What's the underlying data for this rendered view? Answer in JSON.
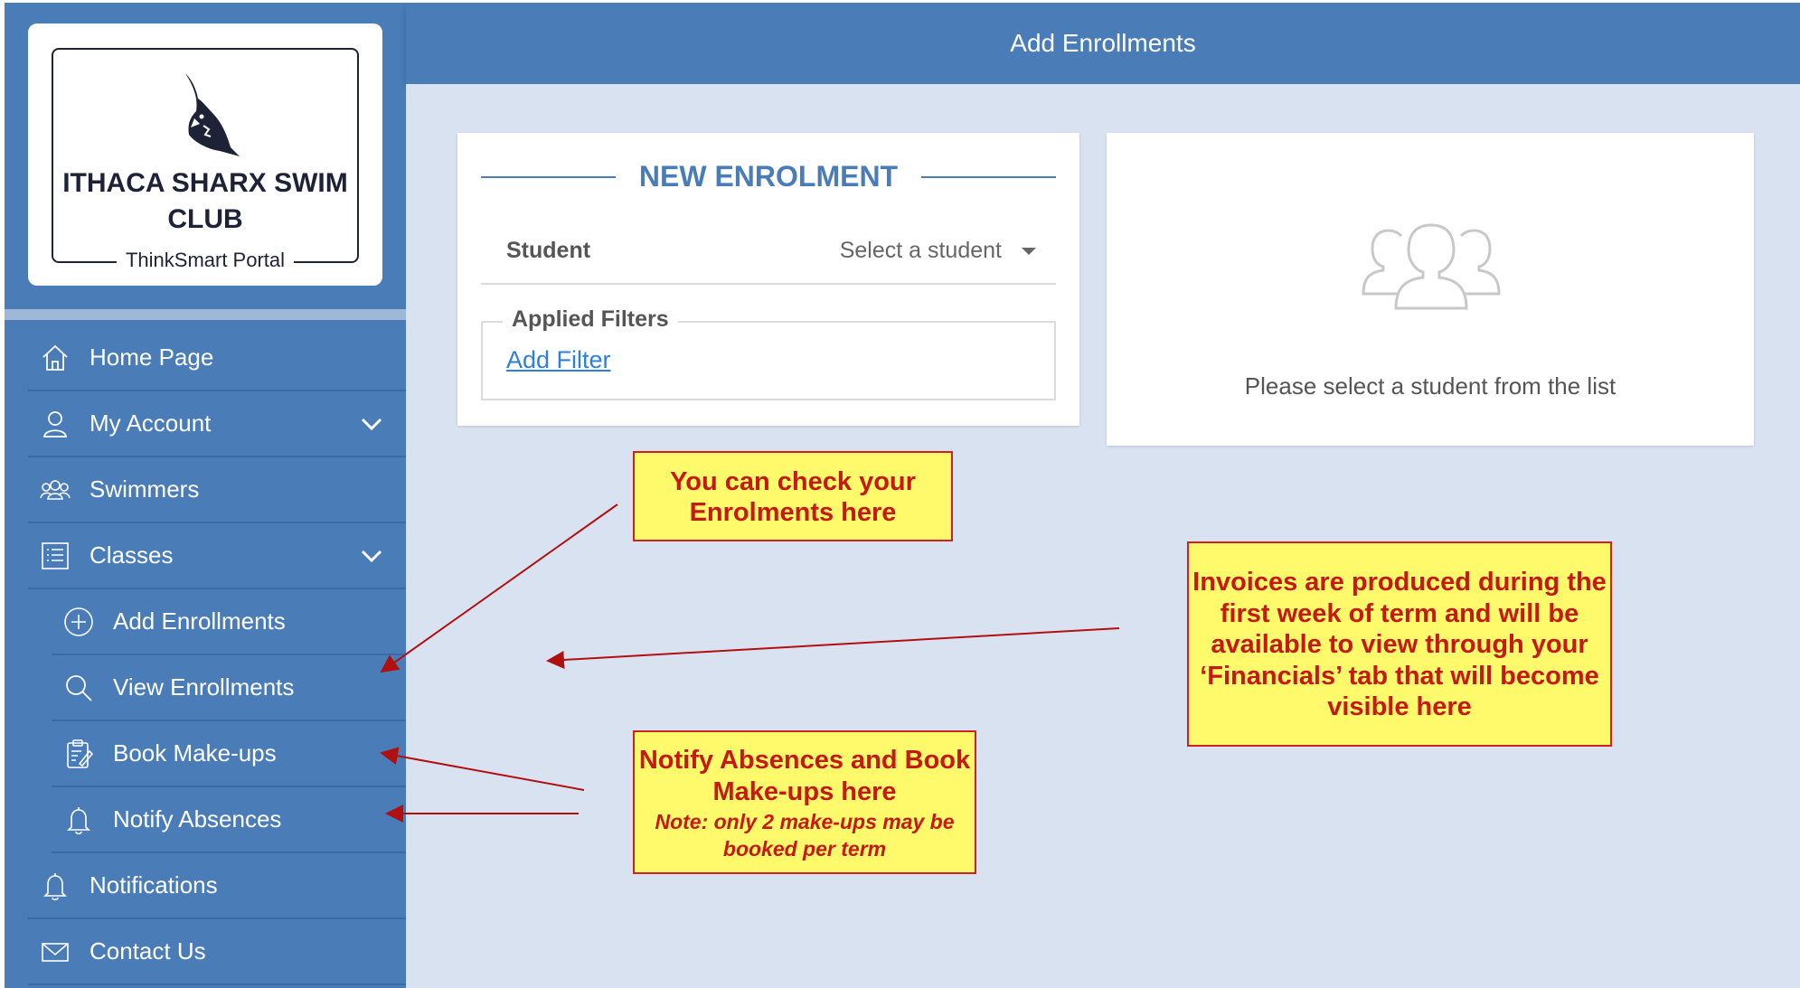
{
  "brand": {
    "club_name": "ITHACA SHARX SWIM CLUB",
    "portal_name": "ThinkSmart Portal"
  },
  "header": {
    "title": "Add Enrollments"
  },
  "sidebar": {
    "items": [
      {
        "label": "Home Page",
        "icon": "home-icon"
      },
      {
        "label": "My Account",
        "icon": "user-icon",
        "expandable": true
      },
      {
        "label": "Swimmers",
        "icon": "group-icon"
      },
      {
        "label": "Classes",
        "icon": "list-icon",
        "expandable": true,
        "expanded": true
      },
      {
        "label": "Add Enrollments",
        "icon": "plus-circle-icon",
        "sub": true
      },
      {
        "label": "View Enrollments",
        "icon": "search-icon",
        "sub": true
      },
      {
        "label": "Book Make-ups",
        "icon": "clipboard-icon",
        "sub": true
      },
      {
        "label": "Notify Absences",
        "icon": "bell-icon",
        "sub": true
      },
      {
        "label": "Notifications",
        "icon": "bell-icon"
      },
      {
        "label": "Contact Us",
        "icon": "envelope-icon"
      }
    ]
  },
  "enrolment": {
    "title": "NEW ENROLMENT",
    "student_label": "Student",
    "student_placeholder": "Select a student",
    "filters_label": "Applied Filters",
    "add_filter_label": "Add Filter"
  },
  "student_panel": {
    "empty_message": "Please select a student from the list"
  },
  "callouts": {
    "enrol": "You can check your Enrolments here",
    "invoice": "Invoices are produced during the first week of term and will be available to view through your ‘Financials’ tab that will become visible here",
    "absence_main": "Notify Absences and Book Make-ups here",
    "absence_note": "Note: only 2 make-ups may be booked per term"
  },
  "colors": {
    "sidebar": "#4a7cb8",
    "content_bg": "#d9e2f0",
    "accent": "#4a7cb8",
    "callout_bg": "#fffa6b",
    "callout_text": "#c41a12"
  }
}
